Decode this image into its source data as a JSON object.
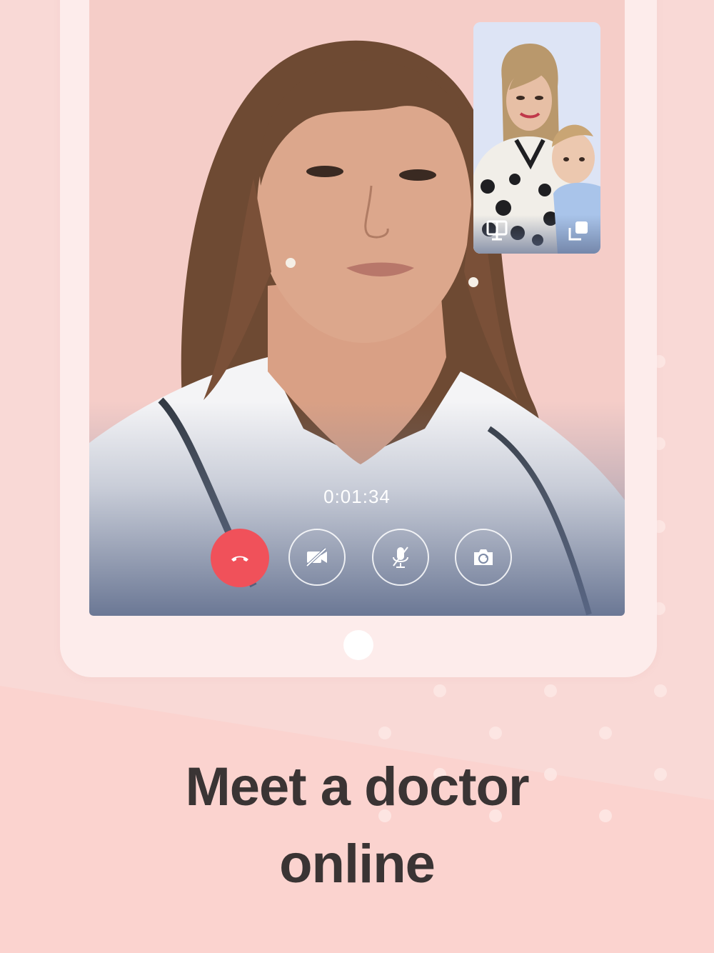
{
  "call": {
    "timer": "0:01:34",
    "end_call_label": "End call",
    "video_toggle_label": "Camera off",
    "mute_label": "Mute microphone",
    "switch_camera_label": "Switch camera"
  },
  "pip": {
    "layout_icon": "layout-split-icon",
    "swap_icon": "swap-view-icon"
  },
  "headline": {
    "line1": "Meet a doctor",
    "line2": "online"
  },
  "colors": {
    "background": "#f9d9d6",
    "end_call": "#f0515a",
    "headline_text": "#3a3434"
  }
}
